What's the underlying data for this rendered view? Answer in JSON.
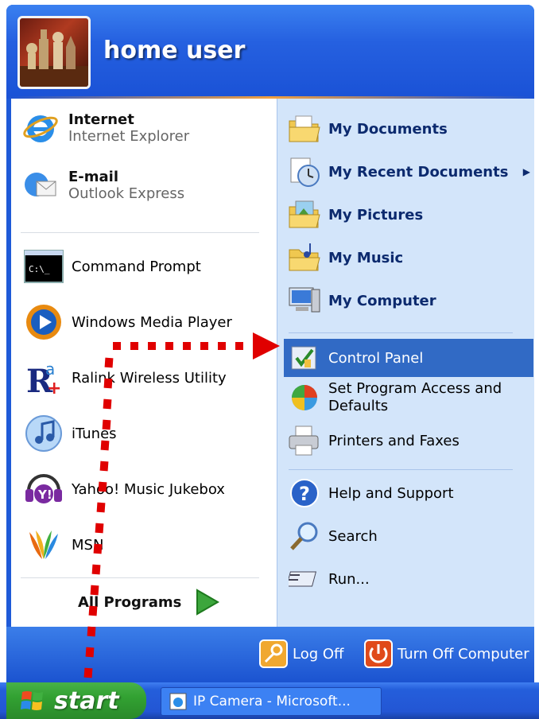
{
  "header": {
    "username": "home user"
  },
  "left": {
    "pinned": [
      {
        "title": "Internet",
        "subtitle": "Internet Explorer",
        "icon": "internet-explorer-icon"
      },
      {
        "title": "E-mail",
        "subtitle": "Outlook Express",
        "icon": "outlook-express-icon"
      }
    ],
    "recent": [
      {
        "label": "Command Prompt",
        "icon": "command-prompt-icon"
      },
      {
        "label": "Windows Media Player",
        "icon": "media-player-icon"
      },
      {
        "label": "Ralink Wireless Utility",
        "icon": "ralink-icon"
      },
      {
        "label": "iTunes",
        "icon": "itunes-icon"
      },
      {
        "label": "Yahoo! Music Jukebox",
        "icon": "yahoo-music-icon"
      },
      {
        "label": "MSN",
        "icon": "msn-icon"
      }
    ],
    "all_programs": "All Programs"
  },
  "right": {
    "items": [
      {
        "label": "My Documents",
        "icon": "my-documents-icon"
      },
      {
        "label": "My Recent Documents",
        "icon": "recent-documents-icon"
      },
      {
        "label": "My Pictures",
        "icon": "my-pictures-icon"
      },
      {
        "label": "My Music",
        "icon": "my-music-icon"
      },
      {
        "label": "My Computer",
        "icon": "my-computer-icon"
      },
      {
        "label": "Control Panel",
        "icon": "control-panel-icon"
      },
      {
        "label": "Set Program Access and Defaults",
        "icon": "program-access-icon"
      },
      {
        "label": "Printers and Faxes",
        "icon": "printers-icon"
      },
      {
        "label": "Help and Support",
        "icon": "help-icon"
      },
      {
        "label": "Search",
        "icon": "search-icon"
      },
      {
        "label": "Run...",
        "icon": "run-icon"
      }
    ]
  },
  "footer": {
    "log_off": "Log Off",
    "turn_off": "Turn Off Computer"
  },
  "taskbar": {
    "start": "start",
    "task_item": "IP Camera - Microsoft..."
  },
  "colors": {
    "highlight": "#316ac5",
    "annotation": "#e00000",
    "start_green": "#32a132",
    "menu_blue": "#1e5ad8"
  }
}
